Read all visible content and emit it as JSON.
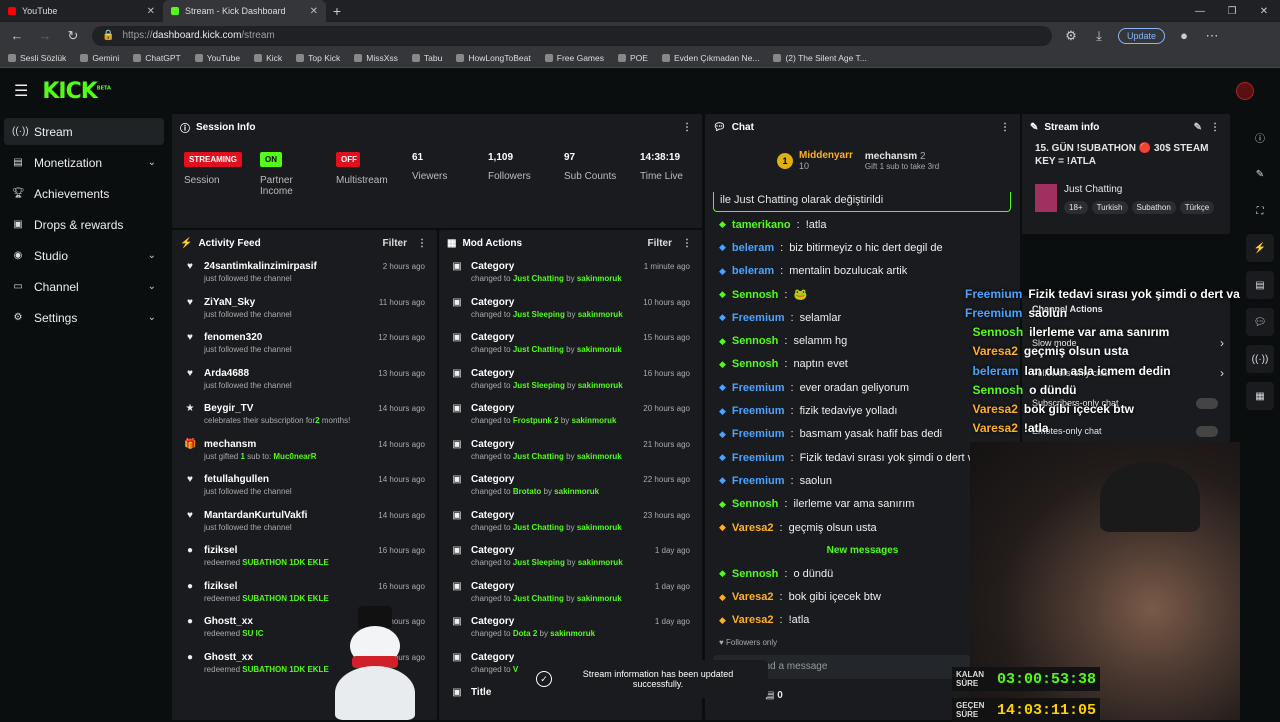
{
  "browser": {
    "tabs": [
      {
        "title": "YouTube"
      },
      {
        "title": "Stream - Kick Dashboard"
      }
    ],
    "url_prefix": "https://",
    "url_host": "dashboard.kick.com",
    "url_path": "/stream",
    "update_label": "Update",
    "bookmarks": [
      "Sesli Sözlük",
      "Gemini",
      "ChatGPT",
      "YouTube",
      "Kick",
      "Top Kick",
      "MissXss",
      "Tabu",
      "HowLongToBeat",
      "Free Games",
      "POE",
      "Evden Çıkmadan Ne...",
      "(2) The Silent Age T..."
    ]
  },
  "brand": {
    "logo": "KICK",
    "beta": "BETA",
    "accent": "#53fc18"
  },
  "sidebar": {
    "items": [
      {
        "label": "Stream"
      },
      {
        "label": "Monetization"
      },
      {
        "label": "Achievements"
      },
      {
        "label": "Drops & rewards"
      },
      {
        "label": "Studio"
      },
      {
        "label": "Channel"
      },
      {
        "label": "Settings"
      }
    ]
  },
  "session": {
    "title": "Session Info",
    "streaming": "STREAMING",
    "on": "ON",
    "off": "OFF",
    "session_label": "Session",
    "partner_label": "Partner Income",
    "multistream_label": "Multistream",
    "stats": [
      {
        "value": "61",
        "label": "Viewers"
      },
      {
        "value": "1,109",
        "label": "Followers"
      },
      {
        "value": "97",
        "label": "Sub Counts"
      },
      {
        "value": "14:38:19",
        "label": "Time Live"
      }
    ]
  },
  "activity": {
    "title": "Activity Feed",
    "filter": "Filter",
    "items": [
      {
        "name": "24santimkalinzimirpasif",
        "sub": "just followed the channel",
        "time": "2 hours ago",
        "icon": "heart"
      },
      {
        "name": "ZiYaN_Sky",
        "sub": "just followed the channel",
        "time": "11 hours ago",
        "icon": "heart"
      },
      {
        "name": "fenomen320",
        "sub": "just followed the channel",
        "time": "12 hours ago",
        "icon": "heart"
      },
      {
        "name": "Arda4688",
        "sub": "just followed the channel",
        "time": "13 hours ago",
        "icon": "heart"
      },
      {
        "name": "Beygir_TV",
        "sub": "celebrates their subscription for",
        "sub2": "2",
        "sub3": " months!",
        "time": "14 hours ago",
        "icon": "star"
      },
      {
        "name": "mechansm",
        "sub": "just gifted ",
        "sub2": "1",
        "sub3": " sub to: ",
        "sub4": "Muc0nearR",
        "time": "14 hours ago",
        "icon": "gift"
      },
      {
        "name": "fetullahgullen",
        "sub": "just followed the channel",
        "time": "14 hours ago",
        "icon": "heart"
      },
      {
        "name": "MantardanKurtulVakfi",
        "sub": "just followed the channel",
        "time": "14 hours ago",
        "icon": "heart"
      },
      {
        "name": "fiziksel",
        "sub": "redeemed ",
        "sub4": "SUBATHON 1DK EKLE",
        "time": "16 hours ago",
        "icon": "drop"
      },
      {
        "name": "fiziksel",
        "sub": "redeemed ",
        "sub4": "SUBATHON 1DK EKLE",
        "time": "16 hours ago",
        "icon": "drop"
      },
      {
        "name": "Ghostt_xx",
        "sub": "redeemed ",
        "sub4": "SU IC",
        "time": "hours ago",
        "icon": "drop"
      },
      {
        "name": "Ghostt_xx",
        "sub": "redeemed ",
        "sub4": "SUBATHON 1DK EKLE",
        "time": "hours ago",
        "icon": "drop"
      }
    ]
  },
  "mod": {
    "title": "Mod Actions",
    "filter": "Filter",
    "items": [
      {
        "title": "Category",
        "prefix": "changed to ",
        "cat": "Just Chatting",
        "by": " by ",
        "user": "sakinmoruk",
        "time": "1 minute ago"
      },
      {
        "title": "Category",
        "prefix": "changed to ",
        "cat": "Just Sleeping",
        "by": " by ",
        "user": "sakinmoruk",
        "time": "10 hours ago"
      },
      {
        "title": "Category",
        "prefix": "changed to ",
        "cat": "Just Chatting",
        "by": " by ",
        "user": "sakinmoruk",
        "time": "15 hours ago"
      },
      {
        "title": "Category",
        "prefix": "changed to ",
        "cat": "Just Sleeping",
        "by": " by ",
        "user": "sakinmoruk",
        "time": "16 hours ago"
      },
      {
        "title": "Category",
        "prefix": "changed to ",
        "cat": "Frostpunk 2",
        "by": " by ",
        "user": "sakinmoruk",
        "time": "20 hours ago"
      },
      {
        "title": "Category",
        "prefix": "changed to ",
        "cat": "Just Chatting",
        "by": " by ",
        "user": "sakinmoruk",
        "time": "21 hours ago"
      },
      {
        "title": "Category",
        "prefix": "changed to ",
        "cat": "Brotato",
        "by": " by ",
        "user": "sakinmoruk",
        "time": "22 hours ago"
      },
      {
        "title": "Category",
        "prefix": "changed to ",
        "cat": "Just Chatting",
        "by": " by ",
        "user": "sakinmoruk",
        "time": "23 hours ago"
      },
      {
        "title": "Category",
        "prefix": "changed to ",
        "cat": "Just Sleeping",
        "by": " by ",
        "user": "sakinmoruk",
        "time": "1 day ago"
      },
      {
        "title": "Category",
        "prefix": "changed to ",
        "cat": "Just Chatting",
        "by": " by ",
        "user": "sakinmoruk",
        "time": "1 day ago"
      },
      {
        "title": "Category",
        "prefix": "changed to ",
        "cat": "Dota 2",
        "by": " by ",
        "user": "sakinmoruk",
        "time": "1 day ago"
      },
      {
        "title": "Category",
        "prefix": "changed to ",
        "cat": "V",
        "by": "",
        "user": "",
        "time": ""
      },
      {
        "title": "Title",
        "prefix": "",
        "cat": "",
        "by": "",
        "user": "",
        "time": ""
      }
    ]
  },
  "chat": {
    "title": "Chat",
    "pinned_user": "Middenyarr",
    "pinned_count": "10",
    "gifter": "mechansm",
    "gifter_count": "2",
    "gift_text": "Gift 1 sub to take 3rd",
    "system_line": "ile Just Chatting olarak değiştirildi",
    "messages": [
      {
        "user": "tamerikano",
        "text": "!atla",
        "color": "#53fc18"
      },
      {
        "user": "beleram",
        "text": "biz bitirmeyiz o hic dert degil de",
        "color": "#4aa3ff"
      },
      {
        "user": "beleram",
        "text": "mentalin bozulucak artik",
        "color": "#4aa3ff"
      },
      {
        "user": "Sennosh",
        "text": "🐸",
        "color": "#53fc18"
      },
      {
        "user": "Freemium",
        "text": "selamlar",
        "color": "#4aa3ff"
      },
      {
        "user": "Sennosh",
        "text": "selamm hg",
        "color": "#53fc18"
      },
      {
        "user": "Sennosh",
        "text": "naptın evet",
        "color": "#53fc18"
      },
      {
        "user": "Freemium",
        "text": "ever oradan geliyorum",
        "color": "#4aa3ff"
      },
      {
        "user": "Freemium",
        "text": "fizik tedaviye yolladı",
        "color": "#4aa3ff"
      },
      {
        "user": "Freemium",
        "text": "basmam yasak hafif bas dedi",
        "color": "#4aa3ff"
      },
      {
        "user": "Freemium",
        "text": "Fizik tedavi sırası yok şimdi o dert va",
        "color": "#4aa3ff"
      },
      {
        "user": "Freemium",
        "text": "saolun",
        "color": "#4aa3ff"
      },
      {
        "user": "Sennosh",
        "text": "ilerleme var ama sanırım",
        "color": "#53fc18"
      },
      {
        "user": "Varesa2",
        "text": "geçmiş olsun usta",
        "color": "#ffb020"
      }
    ],
    "new_messages": "New messages",
    "new": [
      {
        "user": "Sennosh",
        "text": "o dündü",
        "color": "#53fc18"
      },
      {
        "user": "Varesa2",
        "text": "bok gibi içecek btw",
        "color": "#ffb020"
      },
      {
        "user": "Varesa2",
        "text": "!atla",
        "color": "#ffb020"
      }
    ],
    "followers_only": "Followers only",
    "send_placeholder": "end a message",
    "counter": "0"
  },
  "stream_info": {
    "title": "Stream info",
    "stream_title": "15. GÜN !SUBATHON 🔴 30$ STEAM KEY = !ATLA",
    "category": "Just Chatting",
    "tags": [
      "18+",
      "Turkish",
      "Subathon",
      "Türkçe"
    ]
  },
  "channel_actions": {
    "title": "Channel Actions",
    "items": [
      "Slow mode",
      "Followers-only chat",
      "Subscribers-only chat",
      "Emotes-only chat"
    ]
  },
  "overlay_chat": [
    {
      "user": "Freemium",
      "text": "Fizik tedavi sırası yok şimdi o dert var",
      "color": "#4aa3ff"
    },
    {
      "user": "Freemium",
      "text": "saolun",
      "color": "#4aa3ff"
    },
    {
      "user": "Sennosh",
      "text": "ilerleme var ama sanırım",
      "color": "#53fc18"
    },
    {
      "user": "Varesa2",
      "text": "geçmiş olsun usta",
      "color": "#ffb020"
    },
    {
      "user": "beleram",
      "text": "lan dun asla icmem dedin",
      "color": "#4aa3ff"
    },
    {
      "user": "Sennosh",
      "text": "o dündü",
      "color": "#53fc18"
    },
    {
      "user": "Varesa2",
      "text": "bok gibi içecek btw",
      "color": "#ffb020"
    },
    {
      "user": "Varesa2",
      "text": "!atla",
      "color": "#ffb020"
    }
  ],
  "toast": {
    "text": "Stream information has been updated successfully."
  },
  "timers": [
    {
      "label": "KALAN SÜRE",
      "value": "03:00:53:38",
      "color": "#53fc18"
    },
    {
      "label": "GEÇEN SÜRE",
      "value": "14:03:11:05",
      "color": "#ffd000"
    }
  ]
}
